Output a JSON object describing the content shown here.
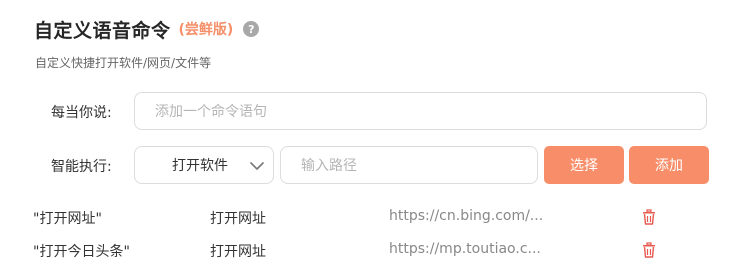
{
  "header": {
    "title": "自定义语音命令",
    "badge": "(尝鲜版)",
    "help_icon": "?",
    "subtitle": "自定义快捷打开软件/网页/文件等"
  },
  "form": {
    "say_label": "每当你说:",
    "command_placeholder": "添加一个命令语句",
    "exec_label": "智能执行:",
    "action_selected": "打开软件",
    "path_placeholder": "输入路径",
    "choose_button": "选择",
    "add_button": "添加"
  },
  "commands": [
    {
      "phrase": "\"打开网址\"",
      "action": "打开网址",
      "target": "https://cn.bing.com/..."
    },
    {
      "phrase": "\"打开今日头条\"",
      "action": "打开网址",
      "target": "https://mp.toutiao.c..."
    }
  ],
  "colors": {
    "accent": "#f78e69",
    "delete_icon": "#e8594f"
  },
  "icons": {
    "help": "question-circle-icon",
    "select": "chevron-down-icon",
    "delete": "trash-icon"
  }
}
